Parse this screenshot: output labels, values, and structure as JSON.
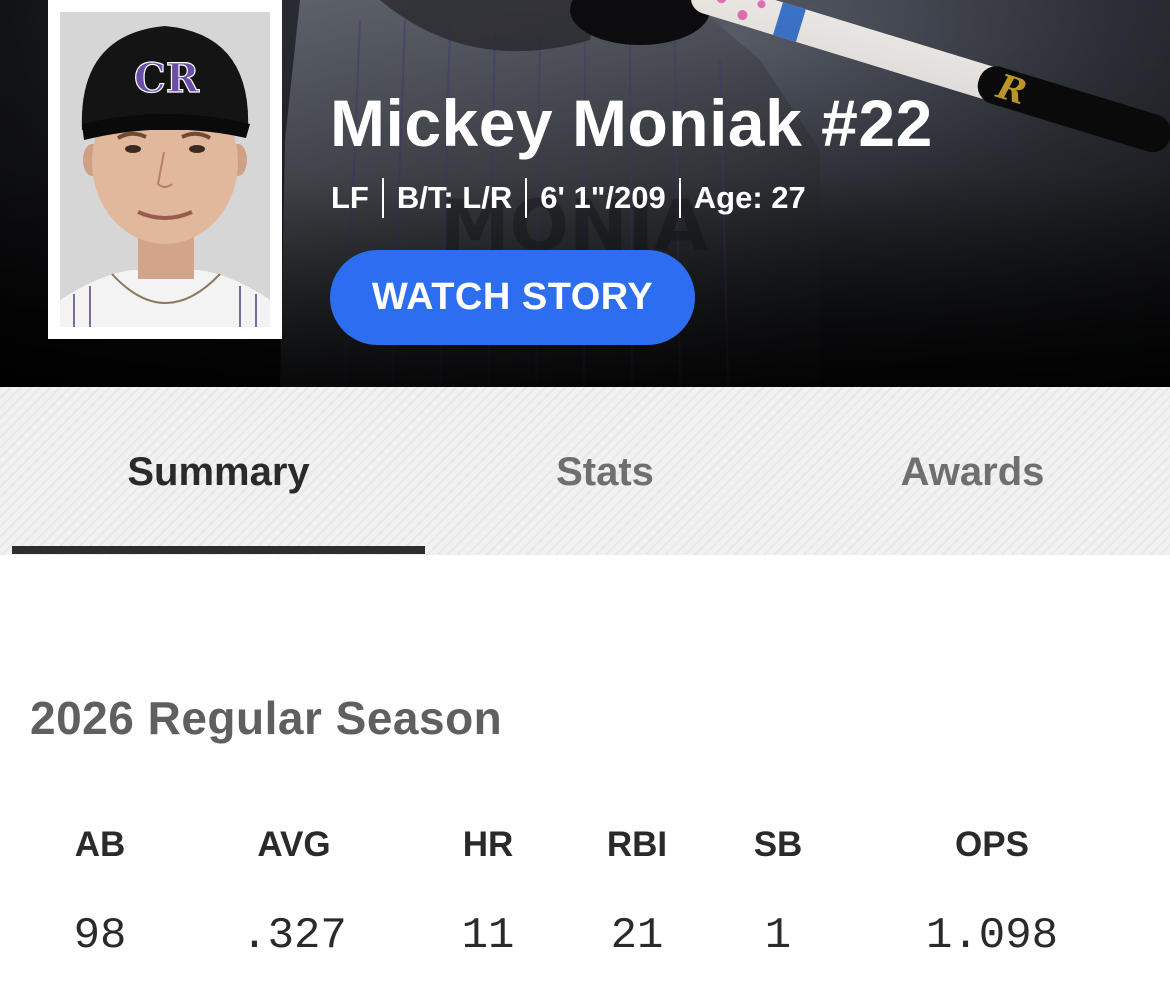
{
  "player": {
    "name": "Mickey Moniak #22",
    "position": "LF",
    "bats_throws": "B/T: L/R",
    "height_weight": "6' 1\"/209",
    "age": "Age: 27",
    "team_logo_letters": "CR"
  },
  "hero": {
    "watch_label": "WATCH STORY",
    "button_color": "#2d6ef0"
  },
  "tabs": [
    {
      "label": "Summary",
      "active": true
    },
    {
      "label": "Stats",
      "active": false
    },
    {
      "label": "Awards",
      "active": false
    }
  ],
  "season": {
    "title": "2026 Regular Season",
    "stats": [
      {
        "label": "AB",
        "value": "98"
      },
      {
        "label": "AVG",
        "value": ".327"
      },
      {
        "label": "HR",
        "value": "11"
      },
      {
        "label": "RBI",
        "value": "21"
      },
      {
        "label": "SB",
        "value": "1"
      },
      {
        "label": "OPS",
        "value": "1.098"
      }
    ]
  },
  "colors": {
    "accent": "#2d6ef0",
    "team_purple": "#33006f",
    "text_dark": "#2a2a2a",
    "text_muted": "#5f5f5f"
  }
}
